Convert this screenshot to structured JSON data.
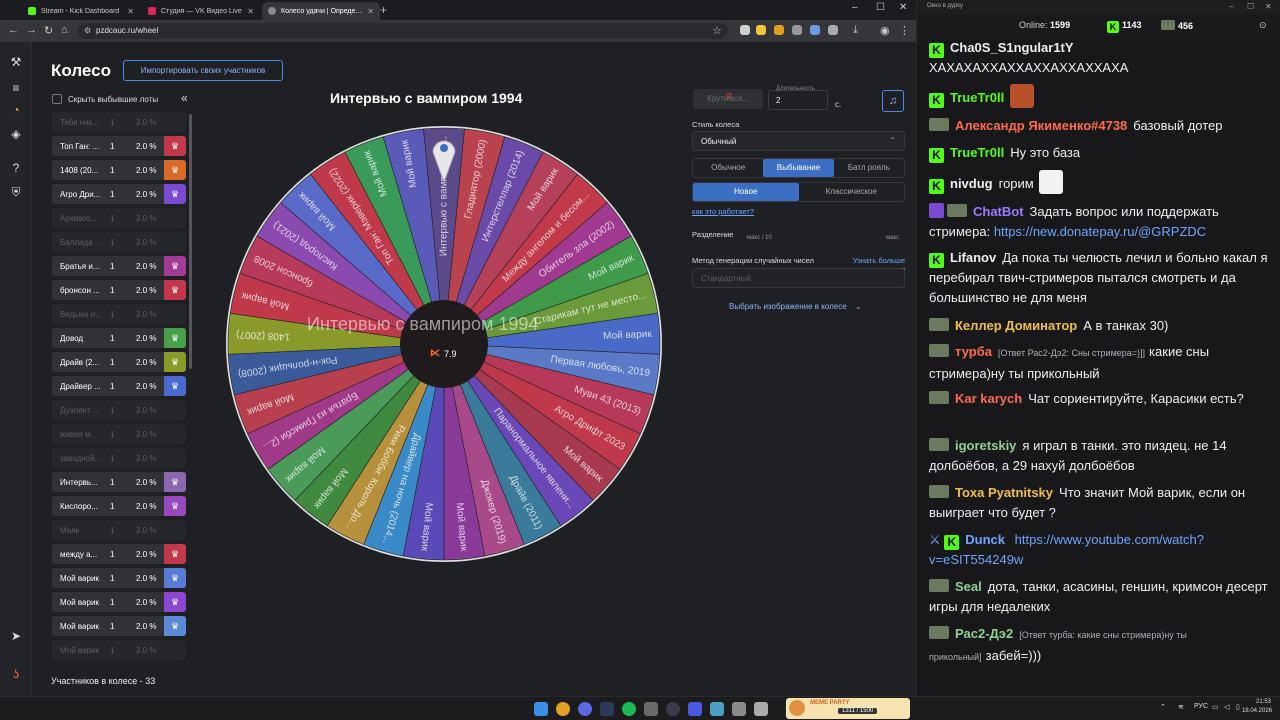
{
  "browser": {
    "tabs": [
      {
        "label": "Stream - Kick Dashboard",
        "color": "#53fc18"
      },
      {
        "label": "Студия — VK Видео Live",
        "color": "#e0245e"
      },
      {
        "label": "Колесо удачи | Определите по",
        "color": "#8a8a8a"
      }
    ],
    "url": "pzdcauc.ru/wheel"
  },
  "page": {
    "title": "Колесо",
    "import_button": "Импортировать своих участников",
    "hide_checkbox": "Скрыть выбывшие лоты",
    "participants_total": "Участников в колесе - 33",
    "wheel_title": "Интервью с вампиром 1994",
    "overlay_text": "Интервью с вампиром 1994",
    "center_rating": "7.9",
    "rows": [
      {
        "name": "Тебя ник...",
        "count": "1",
        "pct": "2.0 %",
        "active": false,
        "color": ""
      },
      {
        "name": "Топ Ган: ...",
        "count": "1",
        "pct": "2.0 %",
        "active": true,
        "color": "#c23a4a"
      },
      {
        "name": "1408 (20...",
        "count": "1",
        "pct": "2.0 %",
        "active": true,
        "color": "#d96a2a"
      },
      {
        "name": "Агро Дри...",
        "count": "1",
        "pct": "2.0 %",
        "active": true,
        "color": "#7a4ad0"
      },
      {
        "name": "Архизсо...",
        "count": "1",
        "pct": "2.0 %",
        "active": false,
        "color": ""
      },
      {
        "name": "Баллада ...",
        "count": "1",
        "pct": "2.0 %",
        "active": false,
        "color": ""
      },
      {
        "name": "Братья и...",
        "count": "1",
        "pct": "2.0 %",
        "active": true,
        "color": "#a23c98"
      },
      {
        "name": "бронсон ...",
        "count": "1",
        "pct": "2.0 %",
        "active": true,
        "color": "#c2384a"
      },
      {
        "name": "Ведьма и...",
        "count": "1",
        "pct": "2.0 %",
        "active": false,
        "color": ""
      },
      {
        "name": "Довод",
        "count": "1",
        "pct": "2.0 %",
        "active": true,
        "color": "#4aa04a"
      },
      {
        "name": "Драйв (2...",
        "count": "1",
        "pct": "2.0 %",
        "active": true,
        "color": "#8a9a2a"
      },
      {
        "name": "Драйвер ...",
        "count": "1",
        "pct": "2.0 %",
        "active": true,
        "color": "#4a6ad0"
      },
      {
        "name": "Дуэлянт ...",
        "count": "1",
        "pct": "2.0 %",
        "active": false,
        "color": ""
      },
      {
        "name": "живая м...",
        "count": "1",
        "pct": "2.0 %",
        "active": false,
        "color": ""
      },
      {
        "name": "заводной...",
        "count": "1",
        "pct": "2.0 %",
        "active": false,
        "color": ""
      },
      {
        "name": "Интервь...",
        "count": "1",
        "pct": "2.0 %",
        "active": true,
        "color": "#8a68b0"
      },
      {
        "name": "Кислоро...",
        "count": "1",
        "pct": "2.0 %",
        "active": true,
        "color": "#9a48c0"
      },
      {
        "name": "Маяк",
        "count": "1",
        "pct": "2.0 %",
        "active": false,
        "color": ""
      },
      {
        "name": "между а...",
        "count": "1",
        "pct": "2.0 %",
        "active": true,
        "color": "#c23a4a"
      },
      {
        "name": "Мой варик",
        "count": "1",
        "pct": "2.0 %",
        "active": true,
        "color": "#5a7ad8"
      },
      {
        "name": "Мой варик",
        "count": "1",
        "pct": "2.0 %",
        "active": true,
        "color": "#8a48d0"
      },
      {
        "name": "Мой варик",
        "count": "1",
        "pct": "2.0 %",
        "active": true,
        "color": "#5a8ad8"
      },
      {
        "name": "Мой варик",
        "count": "1",
        "pct": "2.0 %",
        "active": false,
        "color": ""
      }
    ],
    "settings": {
      "spin_button": "Крутимся...",
      "duration_label": "Длительность",
      "duration_value": "2",
      "duration_unit": "с.",
      "wheel_style_label": "Стиль колеса",
      "wheel_style_value": "Обычный",
      "mode_tabs": [
        "Обычное",
        "Выбывание",
        "Батл рояль"
      ],
      "mode_active": "Выбывание",
      "variant_tabs": [
        "Новое",
        "Классическое"
      ],
      "variant_active": "Новое",
      "how_it_works": "как это работает?",
      "split_label": "Разделение",
      "split_min": "макс / 10",
      "split_max": "макс",
      "rng_label": "Метод генерации случайных чисел",
      "rng_more": "Узнать больше",
      "rng_value": "Стандартный",
      "choose_image": "Выбрать изображение в колесе"
    }
  },
  "wheel": {
    "segments": [
      {
        "label": "Интервью с вампиром 1...",
        "color": "#5b4a8a"
      },
      {
        "label": "Гладиатор (2000)",
        "color": "#b9424f"
      },
      {
        "label": "Интерстеллар (2014)",
        "color": "#6a4aa8"
      },
      {
        "label": "Мой варик",
        "color": "#b4405a"
      },
      {
        "label": "Между ангелом и бесом...",
        "color": "#c23a4a"
      },
      {
        "label": "Обитель зла (2002)",
        "color": "#a03a90"
      },
      {
        "label": "Мой варик",
        "color": "#3f9a4a"
      },
      {
        "label": "Старикам тут не место...",
        "color": "#6a9a3a"
      },
      {
        "label": "Мой варик",
        "color": "#4a6ac8"
      },
      {
        "label": "Первая любовь, 2019",
        "color": "#5a7ac8"
      },
      {
        "label": "Муви 43 (2013)",
        "color": "#b6395a"
      },
      {
        "label": "Агро Дрифт 2023",
        "color": "#c0394a"
      },
      {
        "label": "Мой варик",
        "color": "#a83a50"
      },
      {
        "label": "Паранормальное явлени...",
        "color": "#6a48b8"
      },
      {
        "label": "Драйв (2011)",
        "color": "#3a7a9a"
      },
      {
        "label": "Джокер (2019)",
        "color": "#a84a8a"
      },
      {
        "label": "Мой варик",
        "color": "#8a3a98"
      },
      {
        "label": "Мой варик",
        "color": "#5a4ab8"
      },
      {
        "label": "Драйвер на ночь (2014...",
        "color": "#3a8ac8"
      },
      {
        "label": "Рики Бобби: Король До...",
        "color": "#b6903a"
      },
      {
        "label": "Мой варик",
        "color": "#3f8a3f"
      },
      {
        "label": "Мой варик",
        "color": "#4a9a5a"
      },
      {
        "label": "Братья из Гримсби (2...",
        "color": "#a03a88"
      },
      {
        "label": "Мой варик",
        "color": "#b8404e"
      },
      {
        "label": "Рок-н-рольщик (2008)",
        "color": "#3a5a9a"
      },
      {
        "label": "1408 (2007)",
        "color": "#8a9a2a"
      },
      {
        "label": "Мой варик",
        "color": "#c0394a"
      },
      {
        "label": "бронсон 2008",
        "color": "#b83a5a"
      },
      {
        "label": "Кислород (2021)",
        "color": "#8a4ab0"
      },
      {
        "label": "Мой варик",
        "color": "#5a6ac8"
      },
      {
        "label": "Топ Ган: Мэверик (2022)",
        "color": "#c0394a"
      },
      {
        "label": "Мой варик",
        "color": "#3a9a5a"
      },
      {
        "label": "Мой варик",
        "color": "#5a5ab8"
      }
    ]
  },
  "chat": {
    "window_title": "Окно в дурку",
    "online_label": "Online:",
    "online_value": "1599",
    "kick_value": "1143",
    "vk_value": "456",
    "messages": [
      {
        "user": "Cha0S_S1ngular1tY",
        "color": "#efeff1",
        "badge": "kick",
        "reply": "",
        "text": "",
        "cont": "ХАХАХАХХАХХАХХАХХАХХАХА"
      },
      {
        "user": "TrueTr0ll",
        "color": "#53fc18",
        "badge": "kick",
        "reply": "",
        "text": "",
        "cont": ""
      },
      {
        "user": "Александр Якименко#4738",
        "color": "#ff6b4a",
        "badge": "tank",
        "reply": "",
        "text": "базовый дотер",
        "cont": ""
      },
      {
        "user": "TrueTr0ll",
        "color": "#53fc18",
        "badge": "kick",
        "reply": "",
        "text": "Ну это база",
        "cont": ""
      },
      {
        "user": "nivdug",
        "color": "#efeff1",
        "badge": "kick",
        "reply": "",
        "text": "горим",
        "cont": ""
      },
      {
        "user": "ChatBot",
        "color": "#9d7bff",
        "badge": "bot",
        "reply": "",
        "text": "Задать вопрос или поддержать стримера:",
        "link": "https://new.donatepay.ru/@GRPZDC"
      },
      {
        "user": "Lifanov",
        "color": "#efeff1",
        "badge": "kick",
        "reply": "",
        "text": "Да пока ты челюсть лечил и больно какал я перебирал твич-стримеров пытался смотреть и да большинство не для меня"
      },
      {
        "user": "Келлер Доминатор",
        "color": "#f0c040",
        "badge": "tank",
        "reply": "",
        "text": "А в танках 30)"
      },
      {
        "user": "турба",
        "color": "#ff6b4a",
        "badge": "tank",
        "reply": "[Ответ Рас2-Дэ2: Сны стримера=)]]",
        "text": "какие сны стримера)ну ты прикольный"
      },
      {
        "user": "Kar karych",
        "color": "#ff6b4a",
        "badge": "tank",
        "reply": "",
        "text": "Чат сориентируйте, Карасики есть?"
      },
      {
        "user": "igoretskiy",
        "color": "#8fd18f",
        "badge": "tank",
        "reply": "",
        "text": "я играл в танки. это пиздец. не 14 долбоёбов, а 29 нахуй долбоёбов"
      },
      {
        "user": "Toxa Pyatnitsky",
        "color": "#f0c040",
        "badge": "tank",
        "reply": "",
        "text": "Что значит Мой варик, если он выиграет что будет ?"
      },
      {
        "user": "Dunck",
        "color": "#6aa6ff",
        "badge": "kick",
        "reply": "",
        "text": "",
        "link": "https://www.youtube.com/watch?v=eSIT554249w"
      },
      {
        "user": "Seal",
        "color": "#8fd18f",
        "badge": "tank",
        "reply": "",
        "text": "дота, танки, асасины, геншин, кримсон десерт игры для недалеких"
      },
      {
        "user": "Рас2-Дэ2",
        "color": "#8fd18f",
        "badge": "tank",
        "reply": "[Ответ турба: какие сны стримера)ну ты прикольный]",
        "text": "забей=)))"
      }
    ]
  },
  "taskbar": {
    "lang": "РУС",
    "time": "21:53",
    "date": "18.04.2026",
    "meme_label": "MEME PARTY",
    "meme_counter": "1311 / 1500"
  }
}
